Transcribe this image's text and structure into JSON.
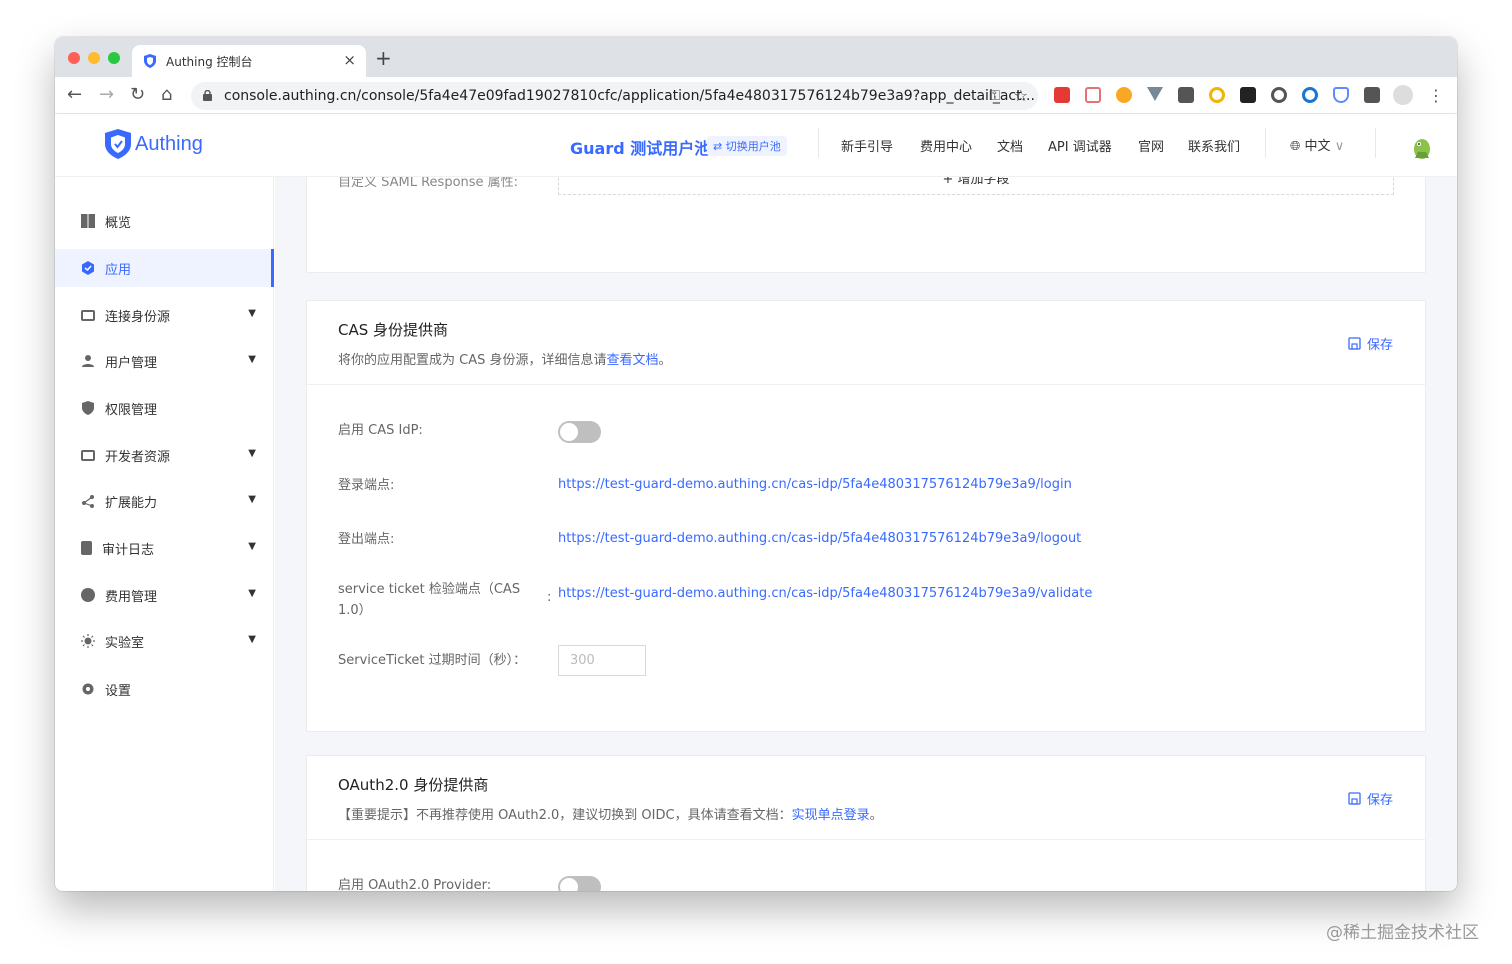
{
  "browser": {
    "tab_title": "Authing 控制台",
    "tab_close": "×",
    "new_tab": "+",
    "url": "console.authing.cn/console/5fa4e47e09fad19027810cfc/application/5fa4e480317576124b79e3a9?app_detail_act...",
    "back": "←",
    "forward": "→",
    "reload": "↻",
    "home": "⌂",
    "key": "⚿",
    "star": "☆",
    "menu": "⋮"
  },
  "header": {
    "logo_text": "Authing",
    "pool_name": "Guard 测试用户池",
    "switch_pool": "⇄ 切换用户池",
    "menu": [
      "新手引导",
      "费用中心",
      "文档",
      "API 调试器",
      "官网",
      "联系我们"
    ],
    "language": "中文",
    "language_chevron": "∨"
  },
  "sidebar": {
    "items": [
      {
        "label": "概览",
        "icon": "dashboard-icon",
        "expandable": false
      },
      {
        "label": "应用",
        "icon": "app-cube-icon",
        "expandable": false,
        "active": true
      },
      {
        "label": "连接身份源",
        "icon": "id-card-icon",
        "expandable": true
      },
      {
        "label": "用户管理",
        "icon": "user-icon",
        "expandable": true
      },
      {
        "label": "权限管理",
        "icon": "shield-icon",
        "expandable": false
      },
      {
        "label": "开发者资源",
        "icon": "code-icon",
        "expandable": true
      },
      {
        "label": "扩展能力",
        "icon": "share-icon",
        "expandable": true
      },
      {
        "label": "审计日志",
        "icon": "file-icon",
        "expandable": true
      },
      {
        "label": "费用管理",
        "icon": "money-icon",
        "expandable": true
      },
      {
        "label": "实验室",
        "icon": "bulb-icon",
        "expandable": true
      },
      {
        "label": "设置",
        "icon": "gear-icon",
        "expandable": false
      }
    ]
  },
  "saml": {
    "label": "自定义 SAML Response 属性:",
    "add_field": "+ 增加字段"
  },
  "cas": {
    "title": "CAS 身份提供商",
    "desc_prefix": "将你的应用配置成为 CAS 身份源，详细信息请",
    "desc_link": "查看文档",
    "desc_suffix": "。",
    "save": "保存",
    "fields": {
      "enable_label": "启用 CAS IdP:",
      "enabled": false,
      "login_label": "登录端点:",
      "login_url": "https://test-guard-demo.authing.cn/cas-idp/5fa4e480317576124b79e3a9/login",
      "logout_label": "登出端点:",
      "logout_url": "https://test-guard-demo.authing.cn/cas-idp/5fa4e480317576124b79e3a9/logout",
      "validate_label": "service ticket 检验端点（CAS 1.0）",
      "validate_colon": ":",
      "validate_url": "https://test-guard-demo.authing.cn/cas-idp/5fa4e480317576124b79e3a9/validate",
      "expire_label": "ServiceTicket 过期时间（秒）：",
      "expire_placeholder": "300"
    }
  },
  "oauth": {
    "title": "OAuth2.0 身份提供商",
    "desc_prefix": "【重要提示】不再推荐使用 OAuth2.0，建议切换到 OIDC，具体请查看文档：",
    "desc_link": "实现单点登录",
    "desc_suffix": "。",
    "save": "保存",
    "enable_label": "启用 OAuth2.0 Provider:",
    "enabled": false
  },
  "watermark": "@稀土掘金技术社区",
  "colors": {
    "accent": "#396aff",
    "active_bg": "#eef3ff"
  }
}
